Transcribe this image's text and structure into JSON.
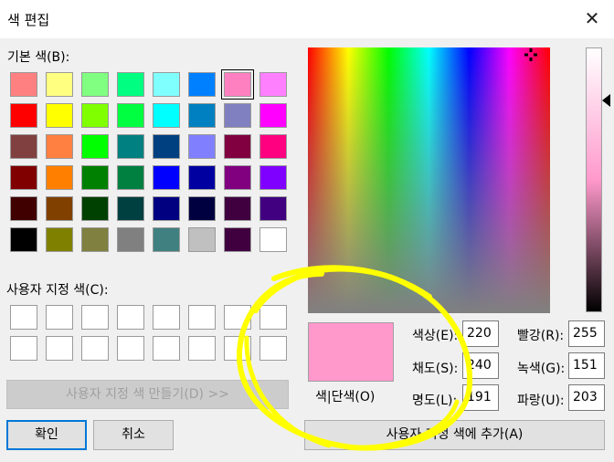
{
  "window": {
    "title": "색 편집",
    "close_icon": "close-icon"
  },
  "basic_colors": {
    "label": "기본 색(B):",
    "swatches": [
      "#ff8080",
      "#ffff80",
      "#80ff80",
      "#00ff80",
      "#80ffff",
      "#0080ff",
      "#ff80c0",
      "#ff80ff",
      "#ff0000",
      "#ffff00",
      "#80ff00",
      "#00ff40",
      "#00ffff",
      "#0080c0",
      "#8080c0",
      "#ff00ff",
      "#804040",
      "#ff8040",
      "#00ff00",
      "#008080",
      "#004080",
      "#8080ff",
      "#800040",
      "#ff0080",
      "#800000",
      "#ff8000",
      "#008000",
      "#008040",
      "#0000ff",
      "#0000a0",
      "#800080",
      "#8000ff",
      "#400000",
      "#804000",
      "#004000",
      "#004040",
      "#000080",
      "#000040",
      "#400040",
      "#400080",
      "#000000",
      "#808000",
      "#808040",
      "#808080",
      "#408080",
      "#c0c0c0",
      "#400040",
      "#ffffff"
    ],
    "selected_index": 6
  },
  "custom_colors": {
    "label": "사용자 지정 색(C):"
  },
  "buttons": {
    "define_custom": "사용자 지정 색 만들기(D) >>",
    "ok": "확인",
    "cancel": "취소",
    "add_custom": "사용자 지정 색에 추가(A)"
  },
  "preview": {
    "label": "색|단색(O)",
    "color": "#ff99cc"
  },
  "fields": {
    "hue": {
      "label": "색상(E):",
      "value": "220"
    },
    "sat": {
      "label": "채도(S):",
      "value": "240"
    },
    "lum": {
      "label": "명도(L):",
      "value": "191"
    },
    "red": {
      "label": "빨강(R):",
      "value": "255"
    },
    "green": {
      "label": "녹색(G):",
      "value": "151"
    },
    "blue": {
      "label": "파랑(U):",
      "value": "203"
    }
  },
  "annotation": {
    "color": "#ffff00"
  }
}
